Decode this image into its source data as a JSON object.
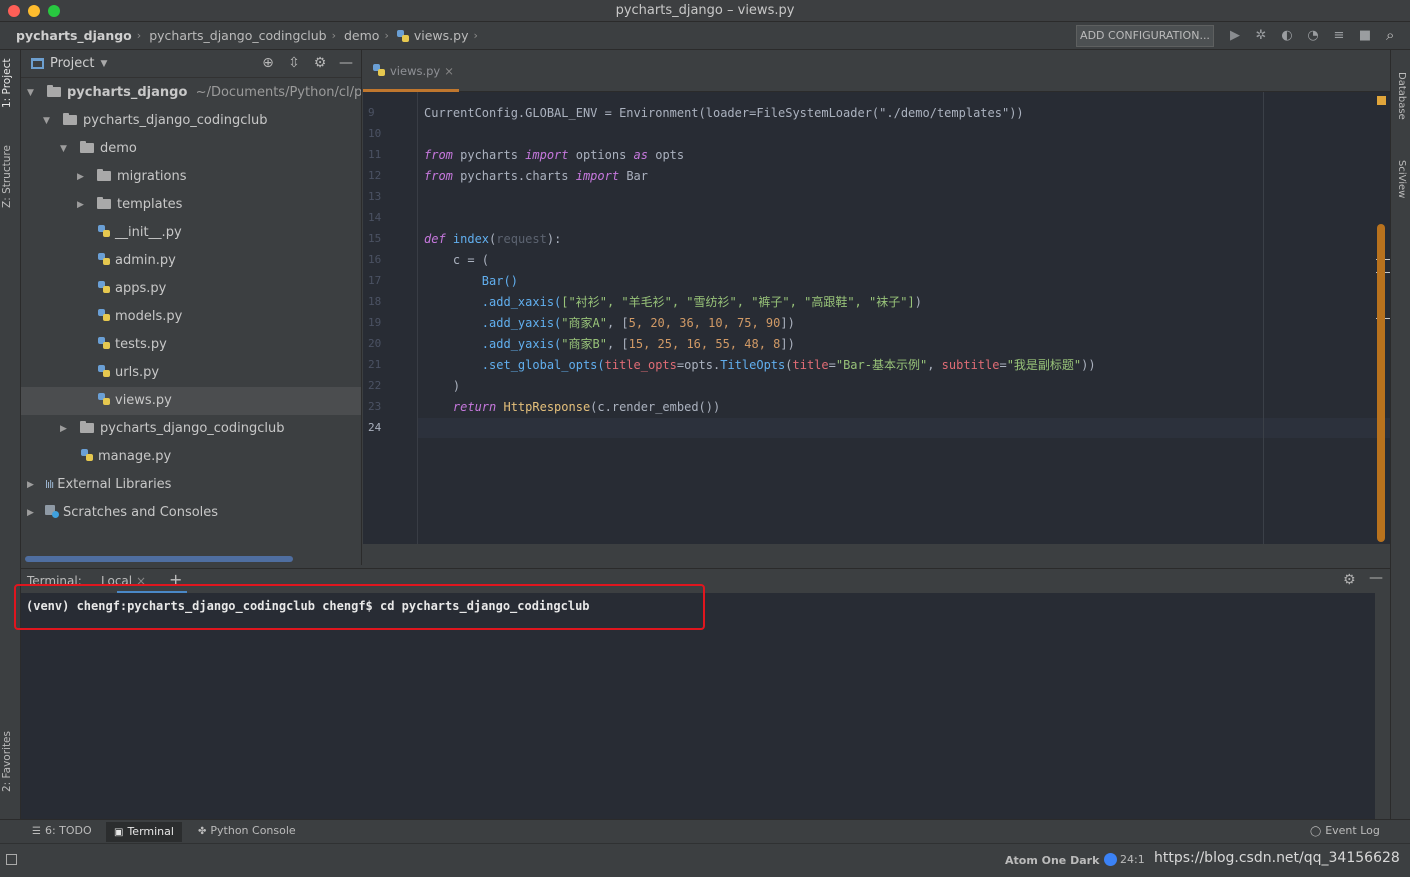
{
  "window": {
    "title": "pycharts_django – views.py"
  },
  "breadcrumbs": [
    "pycharts_django",
    "pycharts_django_codingclub",
    "demo",
    "views.py"
  ],
  "toolbar": {
    "run_config": "ADD CONFIGURATION..."
  },
  "left_stripe": {
    "project_tab": "1: Project",
    "structure_tab": "Z: Structure",
    "favorites_tab": "2: Favorites"
  },
  "right_stripe": {
    "database_tab": "Database",
    "sciview_tab": "SciView"
  },
  "project": {
    "header": "Project",
    "root_name": "pycharts_django",
    "root_path": "~/Documents/Python/cl/pyec",
    "tree": [
      "pycharts_django_codingclub",
      "demo",
      "migrations",
      "templates",
      "__init__.py",
      "admin.py",
      "apps.py",
      "models.py",
      "tests.py",
      "urls.py",
      "views.py",
      "pycharts_django_codingclub",
      "manage.py",
      "External Libraries",
      "Scratches and Consoles"
    ]
  },
  "editor": {
    "tab": "views.py",
    "line_numbers": [
      "9",
      "10",
      "11",
      "12",
      "13",
      "14",
      "15",
      "16",
      "17",
      "18",
      "19",
      "20",
      "21",
      "22",
      "23",
      "24"
    ],
    "code": {
      "l9": "CurrentConfig.GLOBAL_ENV = Environment(loader=FileSystemLoader(\"./demo/templates\"))",
      "l11_kw1": "from",
      "l11_mod": " pycharts ",
      "l11_kw2": "import",
      "l11_rest": " options ",
      "l11_kw3": "as",
      "l11_alias": " opts",
      "l12_kw1": "from",
      "l12_mod": " pycharts.charts ",
      "l12_kw2": "import",
      "l12_rest": " Bar",
      "l15_def": "def",
      "l15_name": " index",
      "l15_open": "(",
      "l15_param": "request",
      "l15_close": "):",
      "l16": "    c = (",
      "l17": "        Bar()",
      "l18_a": "        .add_xaxis(",
      "l18_b": "[\"衬衫\", \"羊毛衫\", \"雪纺衫\", \"裤子\", \"高跟鞋\", \"袜子\"]",
      "l18_c": ")",
      "l19_a": "        .add_yaxis(",
      "l19_s": "\"商家A\"",
      "l19_b": ", [",
      "l19_n": "5, 20, 36, 10, 75, 90",
      "l19_c": "])",
      "l20_a": "        .add_yaxis(",
      "l20_s": "\"商家B\"",
      "l20_b": ", [",
      "l20_n": "15, 25, 16, 55, 48, 8",
      "l20_c": "])",
      "l21_a": "        .set_global_opts(",
      "l21_p1": "title_opts",
      "l21_b": "=opts.",
      "l21_f": "TitleOpts",
      "l21_o": "(",
      "l21_p2": "title",
      "l21_e": "=",
      "l21_s1": "\"Bar-基本示例\"",
      "l21_c": ", ",
      "l21_p3": "subtitle",
      "l21_e2": "=",
      "l21_s2": "\"我是副标题\"",
      "l21_end": "))",
      "l22": "    )",
      "l23_kw": "    return",
      "l23_cls": " HttpResponse",
      "l23_rest": "(c.render_embed())"
    }
  },
  "terminal": {
    "label": "Terminal:",
    "tab": "Local",
    "plus": "+",
    "line": "(venv) chengf:pycharts_django_codingclub chengf$ cd pycharts_django_codingclub"
  },
  "bottom_tabs": {
    "todo": "6: TODO",
    "terminal": "Terminal",
    "python_console": "Python Console",
    "event_log": "Event Log"
  },
  "status": {
    "theme": "Atom One Dark",
    "position": "24:1",
    "watermark": "https://blog.csdn.net/qq_34156628"
  },
  "colors": {
    "accent_orange": "#c0772e",
    "highlight_red": "#e0161e",
    "tab_blue": "#4a88c7"
  }
}
